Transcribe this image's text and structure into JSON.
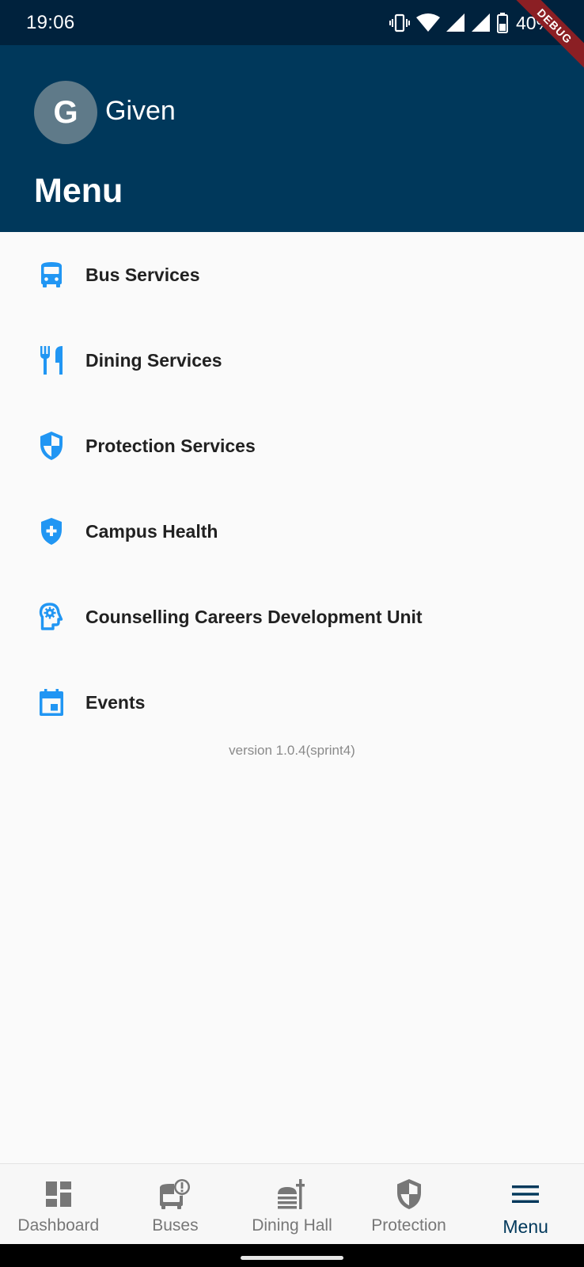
{
  "status_bar": {
    "time": "19:06",
    "battery": "40%",
    "icons": [
      "vibrate-icon",
      "wifi-icon",
      "signal-icon",
      "signal-icon",
      "battery-icon"
    ]
  },
  "debug_banner": "DEBUG",
  "header": {
    "avatar_initial": "G",
    "user_name": "Given",
    "title": "Menu",
    "background_color": "#00385b"
  },
  "menu": {
    "icon_color": "#2196f3",
    "items": [
      {
        "label": "Bus Services",
        "icon": "bus-icon"
      },
      {
        "label": "Dining Services",
        "icon": "restaurant-icon"
      },
      {
        "label": "Protection Services",
        "icon": "shield-icon"
      },
      {
        "label": "Campus Health",
        "icon": "health-shield-icon"
      },
      {
        "label": "Counselling Careers Development Unit",
        "icon": "psychology-icon"
      },
      {
        "label": "Events",
        "icon": "calendar-icon"
      }
    ]
  },
  "version_text": "version 1.0.4(sprint4)",
  "bottom_nav": {
    "active_color": "#00385b",
    "items": [
      {
        "label": "Dashboard",
        "icon": "dashboard-icon",
        "active": false
      },
      {
        "label": "Buses",
        "icon": "bus-alert-icon",
        "active": false
      },
      {
        "label": "Dining Hall",
        "icon": "dining-icon",
        "active": false
      },
      {
        "label": "Protection",
        "icon": "shield-icon",
        "active": false
      },
      {
        "label": "Menu",
        "icon": "menu-icon",
        "active": true
      }
    ]
  }
}
